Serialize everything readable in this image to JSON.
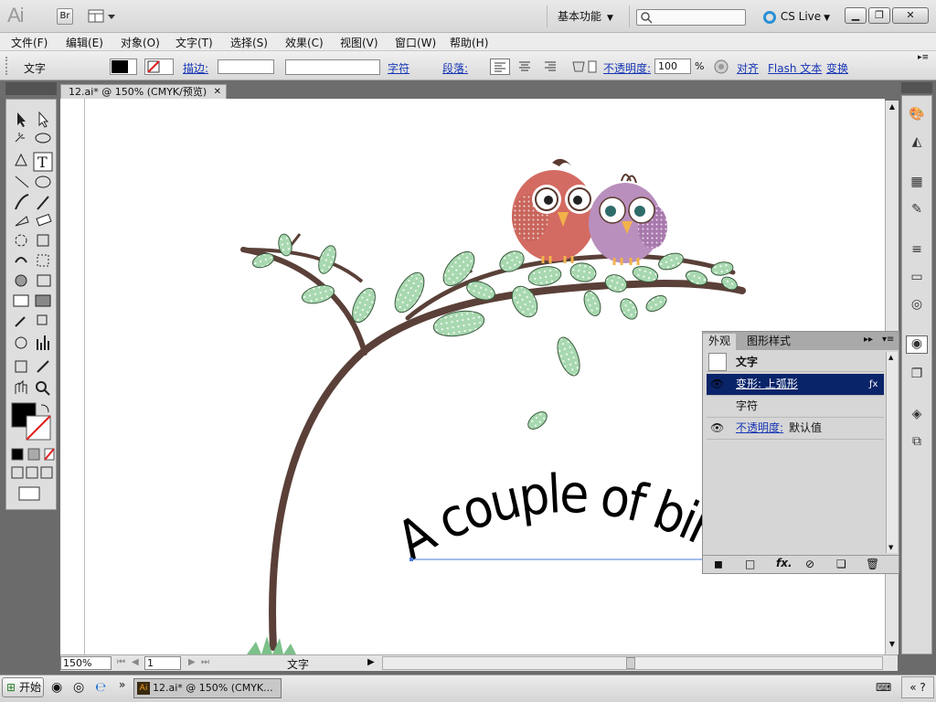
{
  "titlebar": {
    "logo": "Ai",
    "bridge_label": "Br",
    "workspace": "基本功能",
    "cs_live": "CS Live"
  },
  "menu": [
    {
      "label": "文件(F)"
    },
    {
      "label": "编辑(E)"
    },
    {
      "label": "对象(O)"
    },
    {
      "label": "文字(T)"
    },
    {
      "label": "选择(S)"
    },
    {
      "label": "效果(C)"
    },
    {
      "label": "视图(V)"
    },
    {
      "label": "窗口(W)"
    },
    {
      "label": "帮助(H)"
    }
  ],
  "control": {
    "selection_type": "文字",
    "stroke_label": "描边:",
    "char_label": "字符",
    "para_label": "段落:",
    "opacity_label": "不透明度:",
    "opacity_value": "100",
    "opacity_unit": "%",
    "align_label": "对齐",
    "flash_text_label": "Flash 文本",
    "transform_label": "变换",
    "fill_color": "#000000"
  },
  "document": {
    "tab_title": "12.ai* @ 150% (CMYK/预览)",
    "artwork_text": "A couple of birds"
  },
  "status": {
    "zoom": "150%",
    "page": "1",
    "tool_name": "文字"
  },
  "appearance_panel": {
    "tabs": [
      "外观",
      "图形样式"
    ],
    "object_type": "文字",
    "rows": [
      {
        "label": "变形: 上弧形"
      },
      {
        "label": "字符"
      },
      {
        "label": "不透明度:",
        "value": "默认值"
      }
    ]
  },
  "taskbar": {
    "start_label": "开始",
    "task_label": "12.ai* @ 150% (CMYK..."
  },
  "colors": {
    "trunk": "#5a4038",
    "leaf": "#a8d8b0",
    "red_bird": "#d46b62",
    "purple_bird": "#b98fbd",
    "selected_row": "#0a246a"
  }
}
